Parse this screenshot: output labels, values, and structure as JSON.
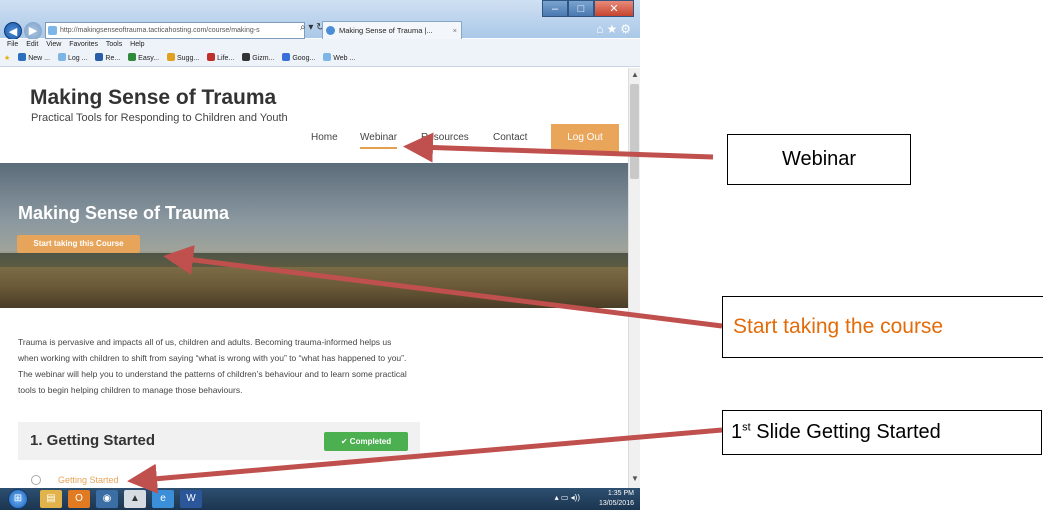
{
  "browser": {
    "address": "http://makingsenseoftrauma.tacticahosting.com/course/making-s",
    "tab_title": "Making Sense of Trauma |...",
    "tab_close": "×",
    "menu": [
      "File",
      "Edit",
      "View",
      "Favorites",
      "Tools",
      "Help"
    ],
    "favorites": [
      "New ...",
      "Log ...",
      "Re...",
      "Easy...",
      "Sugg...",
      "Life...",
      "Gizm...",
      "Goog...",
      "Web ..."
    ]
  },
  "site": {
    "title": "Making Sense of Trauma",
    "tagline": "Practical Tools for Responding to Children and Youth",
    "nav": {
      "home": "Home",
      "webinar": "Webinar",
      "resources": "Resources",
      "contact": "Contact"
    },
    "logout": "Log Out"
  },
  "hero": {
    "title": "Making Sense of Trauma",
    "button": "Start taking this Course"
  },
  "intro": "Trauma is pervasive and impacts all of us, children and adults. Becoming trauma-informed helps us when working with children to shift from saying “what is wrong with you” to “what has happened to you”. The webinar will help you to understand the patterns of children’s behaviour and to learn some practical tools to begin helping children to manage those behaviours.",
  "section": {
    "title": "1.  Getting Started",
    "status": "✔  Completed",
    "lesson": "Getting Started"
  },
  "taskbar": {
    "time": "1:35 PM",
    "date": "13/05/2016"
  },
  "callouts": {
    "webinar": "Webinar",
    "start": "Start taking the course",
    "slide_prefix": "1",
    "slide_sup": "st",
    "slide_rest": " Slide Getting Started"
  },
  "colors": {
    "accent_orange": "#e6a55a",
    "completed_green": "#4caf50",
    "arrow_red": "#c0504d",
    "callout_orange_text": "#e36c09"
  }
}
